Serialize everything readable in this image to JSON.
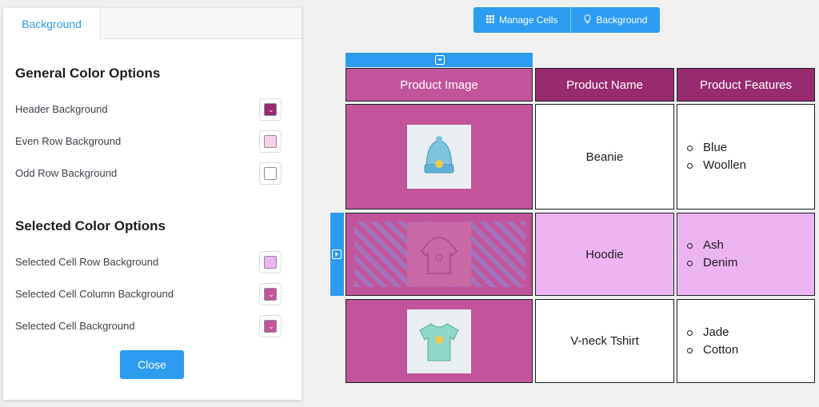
{
  "panel": {
    "tab_label": "Background",
    "general_title": "General Color Options",
    "general_options": [
      {
        "label": "Header Background",
        "color": "#972b6d"
      },
      {
        "label": "Even Row Background",
        "color": "#f7d2e8"
      },
      {
        "label": "Odd Row Background",
        "color": "#ffffff"
      }
    ],
    "selected_title": "Selected Color Options",
    "selected_options": [
      {
        "label": "Selected Cell Row Background",
        "color": "#ecb4f1"
      },
      {
        "label": "Selected Cell Column Background",
        "color": "#c25599"
      },
      {
        "label": "Selected Cell Background",
        "color": "#c25599"
      }
    ],
    "close_label": "Close"
  },
  "toolbar": {
    "manage_cells_label": "Manage Cells",
    "manage_cells_icon": "grid-icon",
    "background_label": "Background",
    "background_icon": "bulb-icon"
  },
  "table": {
    "headers": [
      "Product Image",
      "Product Name",
      "Product Features"
    ],
    "rows": [
      {
        "image": "beanie-image",
        "name": "Beanie",
        "features": [
          "Blue",
          "Woollen"
        ]
      },
      {
        "image": "hoodie-image",
        "name": "Hoodie",
        "features": [
          "Ash",
          "Denim"
        ]
      },
      {
        "image": "tshirt-image",
        "name": "V-neck Tshirt",
        "features": [
          "Jade",
          "Cotton"
        ]
      }
    ]
  },
  "colors": {
    "accent": "#2d9bf0",
    "header_bg": "#972b6d",
    "selected_column": "#c25599",
    "selected_row": "#ecb4f1"
  }
}
